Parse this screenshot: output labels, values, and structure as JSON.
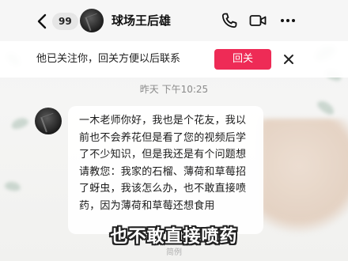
{
  "header": {
    "unread_count": "99",
    "contact_name": "球场王后雄",
    "icons": {
      "back": "chevron-left-icon",
      "call": "phone-icon",
      "video": "video-camera-icon",
      "more": "more-horizontal-icon"
    }
  },
  "follow_banner": {
    "text": "他已关注你，回关方便以后联系",
    "button_label": "回关",
    "close_icon": "close-icon",
    "button_color": "#ee2b56"
  },
  "chat": {
    "timestamp": "昨天 下午10:25",
    "messages": [
      {
        "sender": "contact",
        "text": "一木老师你好，我也是个花友，我以前也不会养花但是看了您的视频后学了不少知识，但是我还是有个问题想请教您：我家的石榴、薄荷和草莓招了蚜虫，我该怎么办，也不敢直接喷药，因为薄荷和草莓还想食用"
      }
    ]
  },
  "subtitle": "也不敢直接喷药",
  "bottom_hint": "简例"
}
